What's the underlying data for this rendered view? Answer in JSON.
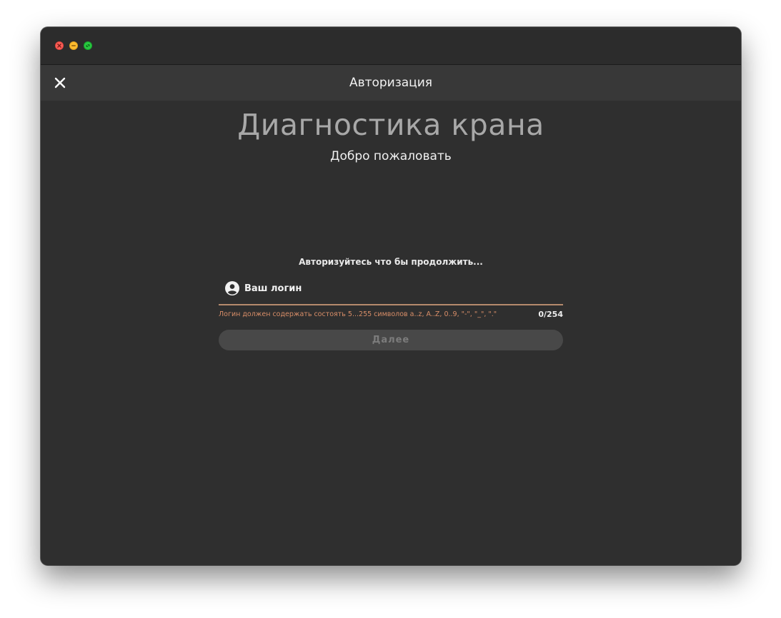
{
  "window": {
    "controls": [
      "close",
      "minimize",
      "maximize"
    ]
  },
  "appbar": {
    "close_icon": "close-icon",
    "title": "Авторизация"
  },
  "main": {
    "title": "Диагностика крана",
    "subtitle": "Добро пожаловать",
    "prompt": "Авторизуйтесь что бы продолжить...",
    "login": {
      "icon": "account-circle-icon",
      "placeholder": "Ваш логин",
      "value": "",
      "hint": "Логин должен содержать состоять 5...255 символов a..z, A..Z, 0..9, \"-\", \"_\", \".\"",
      "counter": "0/254"
    },
    "next_button": "Далее"
  },
  "colors": {
    "background": "#2f2f2f",
    "appbar": "#383838",
    "accent_underline": "#b58a6c",
    "hint": "#d98e68",
    "button_disabled": "#484848"
  }
}
